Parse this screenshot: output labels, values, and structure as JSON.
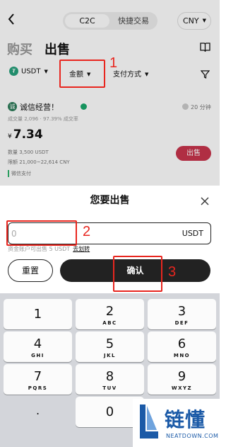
{
  "topbar": {
    "seg_active": "C2C",
    "seg_other": "快捷交易",
    "currency": "CNY"
  },
  "tabs": {
    "buy": "购买",
    "sell": "出售"
  },
  "filters": {
    "asset": "USDT",
    "amount": "金额",
    "payment": "支付方式"
  },
  "offer": {
    "merchant": "诚信经营！",
    "time": "20 分钟",
    "stats": "成交量 2,096 · 97.39% 成交率",
    "currency_symbol": "¥",
    "price": "7.34",
    "quantity": "数量 3,500 USDT",
    "limit": "限额 21,000~22,614 CNY",
    "payment": "微信支付",
    "sell_label": "出售"
  },
  "sheet": {
    "title": "您要出售",
    "input_value": "",
    "input_placeholder": "0",
    "unit": "USDT",
    "balance": "资金账户可出售 5 USDT",
    "transfer": "去划转",
    "reset": "重置",
    "confirm": "确认"
  },
  "annotations": {
    "one": "1",
    "two": "2",
    "three": "3"
  },
  "keypad": {
    "keys": [
      {
        "digit": "1",
        "letters": ""
      },
      {
        "digit": "2",
        "letters": "ABC"
      },
      {
        "digit": "3",
        "letters": "DEF"
      },
      {
        "digit": "4",
        "letters": "GHI"
      },
      {
        "digit": "5",
        "letters": "JKL"
      },
      {
        "digit": "6",
        "letters": "MNO"
      },
      {
        "digit": "7",
        "letters": "PQRS"
      },
      {
        "digit": "8",
        "letters": "TUV"
      },
      {
        "digit": "9",
        "letters": "WXYZ"
      },
      {
        "digit": "0",
        "letters": ""
      }
    ],
    "dot": "."
  },
  "watermark": {
    "name": "链懂",
    "sub": "NEATDOWN.COM"
  },
  "colors": {
    "sell_button": "#c9354d",
    "annotation": "#e8261f",
    "confirm_button": "#222222",
    "watermark": "#1b5aa7"
  },
  "icons": [
    "back-icon",
    "caret-down-icon",
    "book-icon",
    "funnel-icon",
    "verified-icon",
    "clock-icon",
    "close-icon",
    "backspace-icon"
  ]
}
